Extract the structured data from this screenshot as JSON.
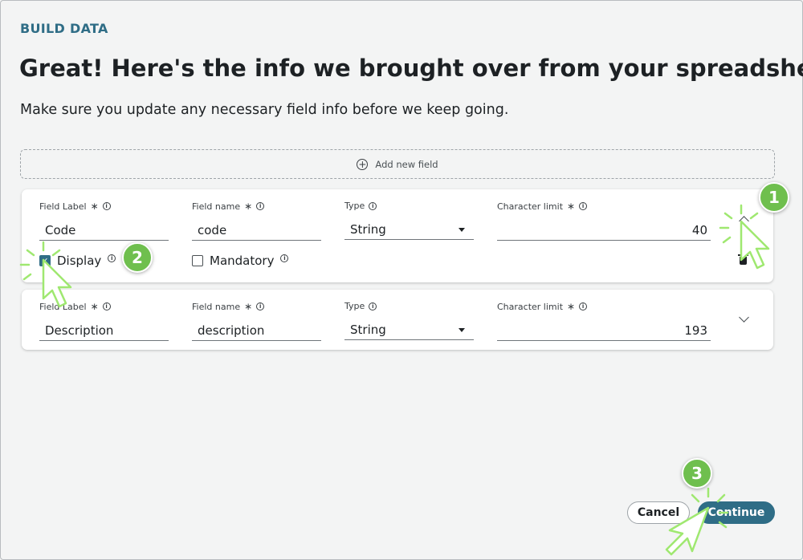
{
  "header": {
    "eyebrow": "BUILD DATA",
    "title": "Great! Here's the info we brought over from your spreadsheet",
    "subtitle": "Make sure you update any necessary field info before we keep going."
  },
  "add_field": {
    "label": "Add new field"
  },
  "labels": {
    "field_label": "Field Label",
    "field_name": "Field name",
    "type": "Type",
    "char_limit": "Character limit",
    "required_mark": "∗"
  },
  "fields": [
    {
      "label": "Code",
      "name": "code",
      "type": "String",
      "char_limit": "40",
      "expanded": true,
      "display_label": "Display",
      "display_checked": true,
      "mandatory_label": "Mandatory",
      "mandatory_checked": false
    },
    {
      "label": "Description",
      "name": "description",
      "type": "String",
      "char_limit": "193",
      "expanded": false
    }
  ],
  "footer": {
    "cancel_label": "Cancel",
    "continue_label": "Continue"
  },
  "annotations": [
    {
      "number": "1"
    },
    {
      "number": "2"
    },
    {
      "number": "3"
    }
  ],
  "colors": {
    "accent": "#2f6d86",
    "badge": "#6fbf4e",
    "cursor_highlight": "#9fe870"
  }
}
